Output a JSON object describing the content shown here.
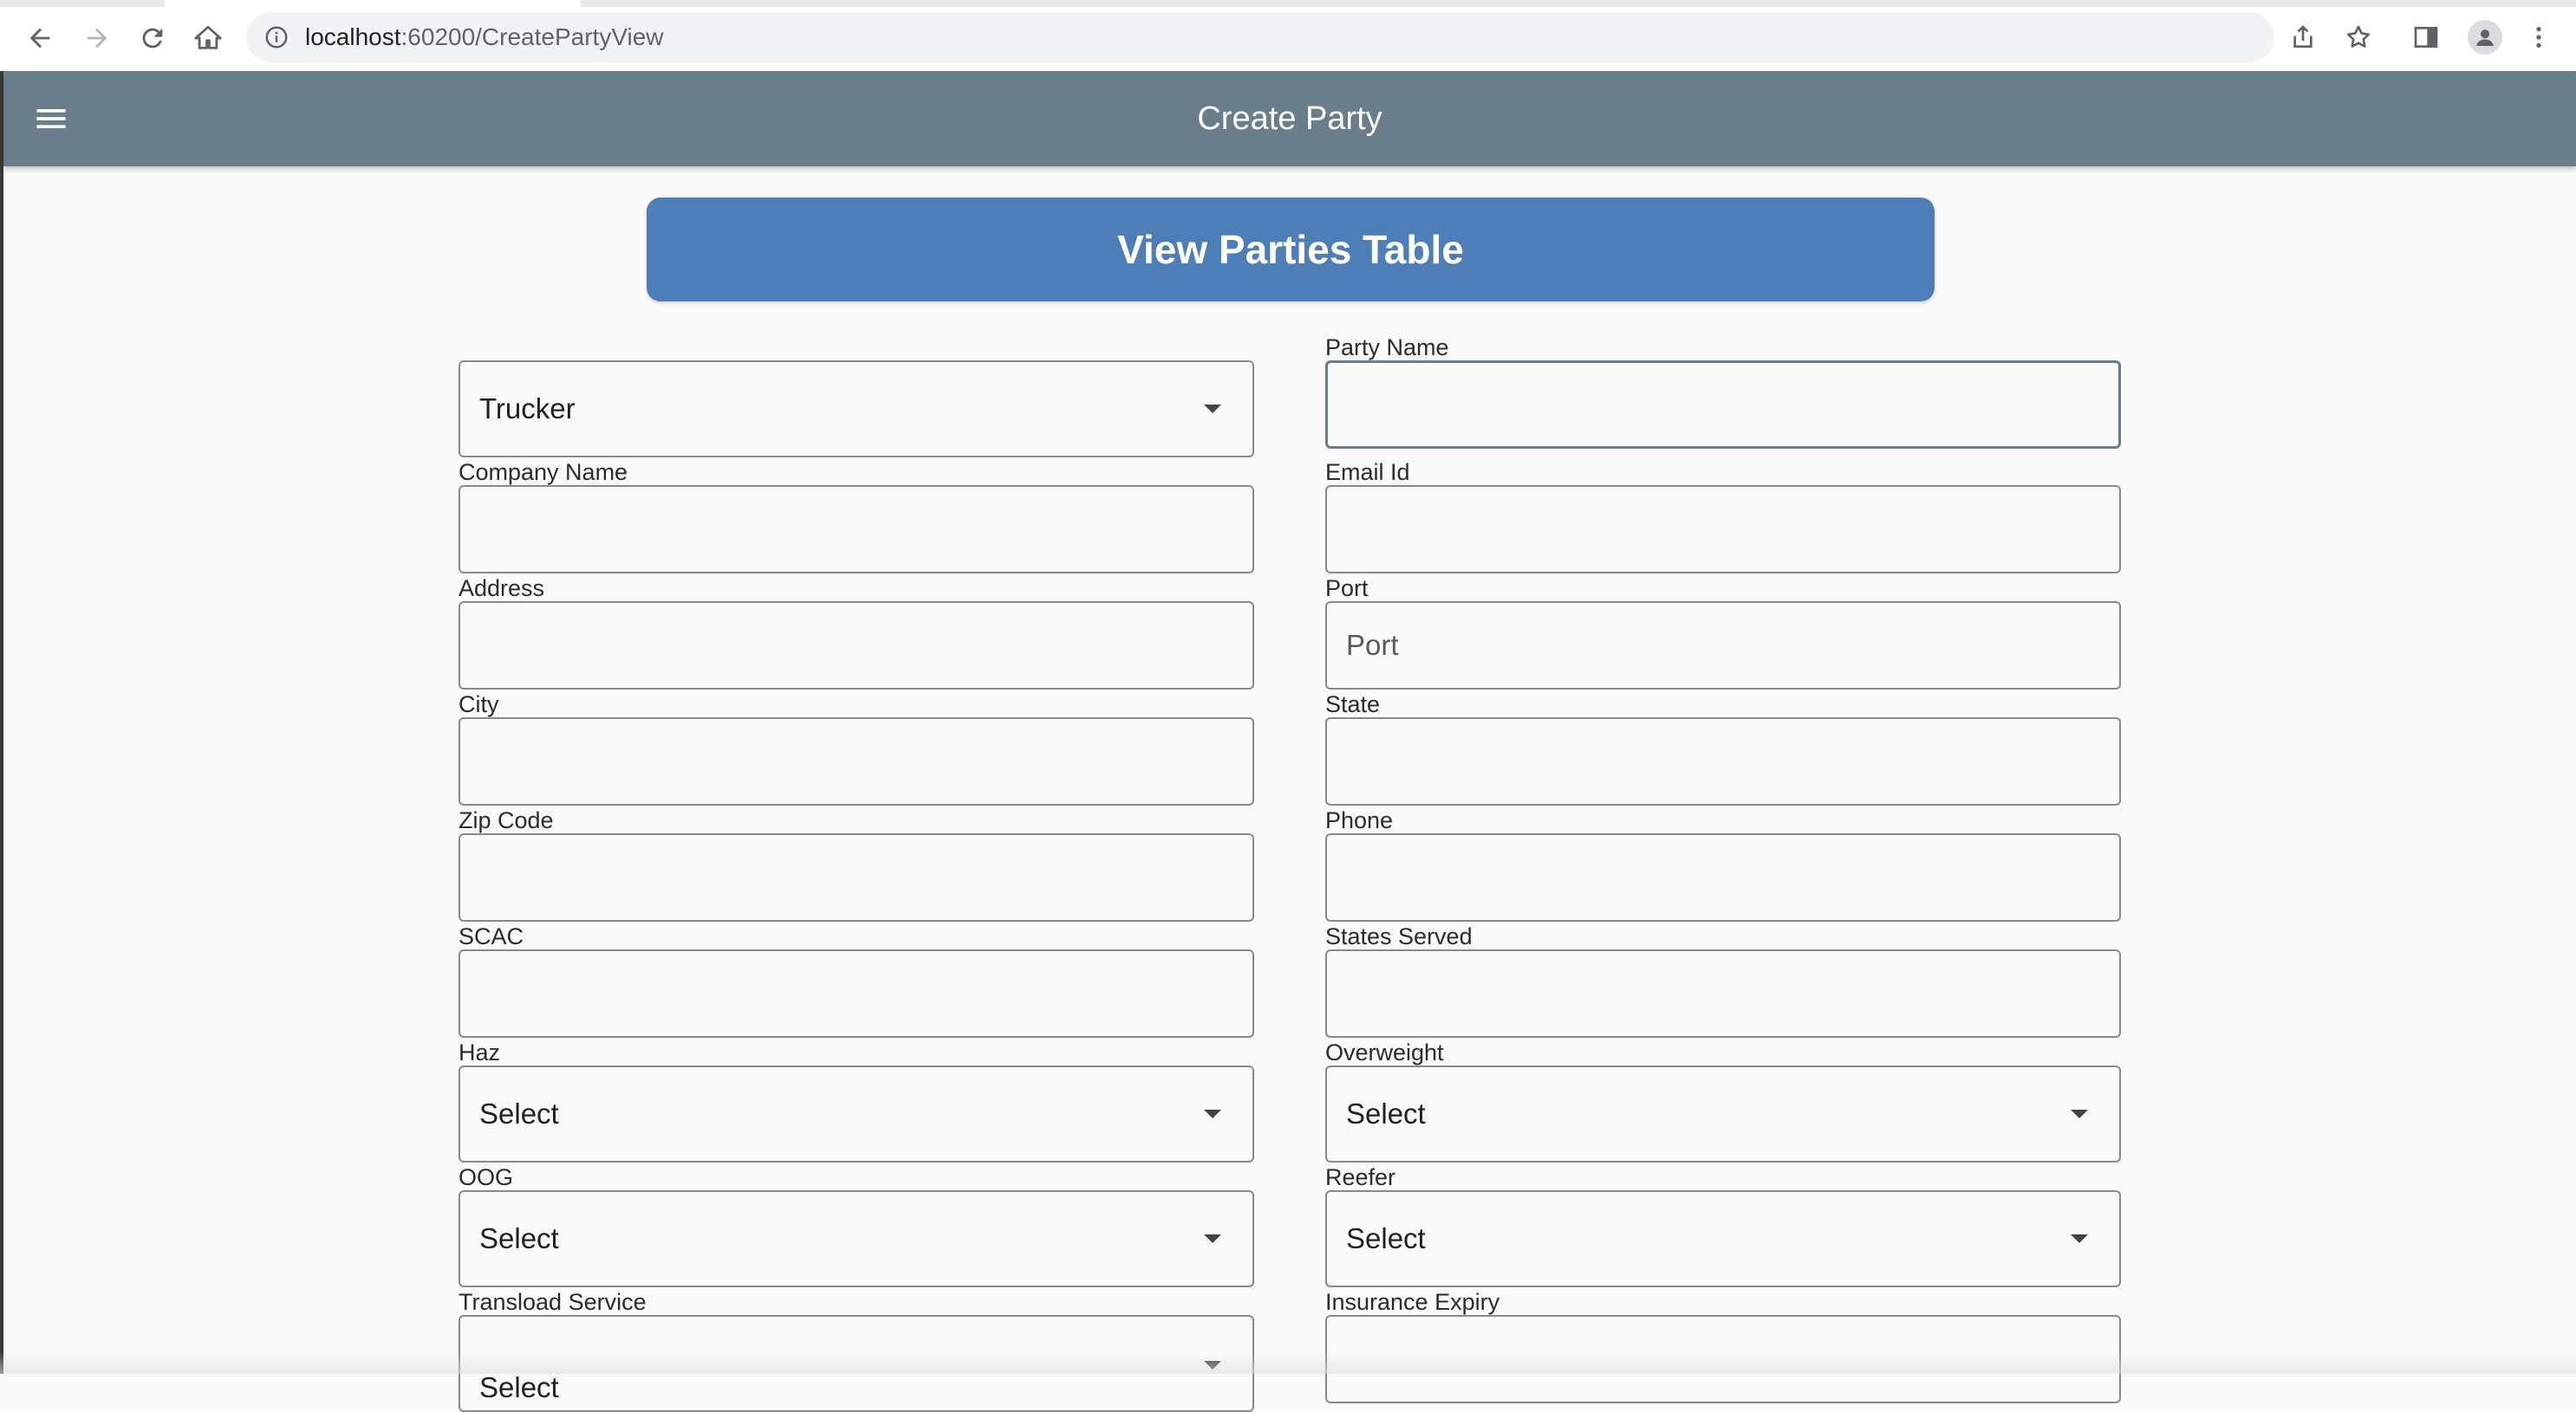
{
  "browser": {
    "url_host": "localhost",
    "url_rest": ":60200/CreatePartyView"
  },
  "app_bar": {
    "title": "Create Party"
  },
  "view_table_button": "View Parties Table",
  "form": {
    "party_type": {
      "value": "Trucker"
    },
    "party_name": {
      "label": "Party Name",
      "value": "",
      "placeholder": ""
    },
    "company_name": {
      "label": "Company Name",
      "value": "",
      "placeholder": ""
    },
    "email_id": {
      "label": "Email Id",
      "value": "",
      "placeholder": ""
    },
    "address": {
      "label": "Address",
      "value": "",
      "placeholder": ""
    },
    "port": {
      "label": "Port",
      "value": "",
      "placeholder": "Port"
    },
    "city": {
      "label": "City",
      "value": "",
      "placeholder": ""
    },
    "state": {
      "label": "State",
      "value": "",
      "placeholder": ""
    },
    "zip_code": {
      "label": "Zip Code",
      "value": "",
      "placeholder": ""
    },
    "phone": {
      "label": "Phone",
      "value": "",
      "placeholder": ""
    },
    "scac": {
      "label": "SCAC",
      "value": "",
      "placeholder": ""
    },
    "states_served": {
      "label": "States Served",
      "value": "",
      "placeholder": ""
    },
    "haz": {
      "label": "Haz",
      "value": "Select"
    },
    "overweight": {
      "label": "Overweight",
      "value": "Select"
    },
    "oog": {
      "label": "OOG",
      "value": "Select"
    },
    "reefer": {
      "label": "Reefer",
      "value": "Select"
    },
    "transload_service": {
      "label": "Transload Service",
      "value": "Select"
    },
    "insurance_expiry": {
      "label": "Insurance Expiry",
      "value": "",
      "placeholder": ""
    }
  }
}
